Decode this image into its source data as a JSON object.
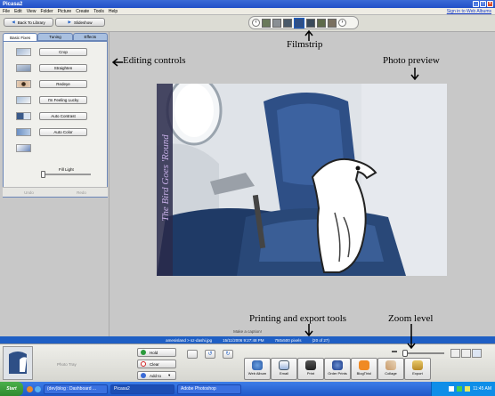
{
  "window": {
    "title": "Picasa2",
    "sign_in": "Sign in to Web Albums"
  },
  "menu": [
    "File",
    "Edit",
    "View",
    "Folder",
    "Picture",
    "Create",
    "Tools",
    "Help"
  ],
  "top": {
    "back_label": "Back To Library",
    "slideshow_label": "Slideshow"
  },
  "tabs": [
    "Basic Fixes",
    "Tuning",
    "Effects"
  ],
  "tools": [
    "Crop",
    "Straighten",
    "Redeye",
    "I'm Feeling Lucky",
    "Auto Contrast",
    "Auto Color"
  ],
  "fill_light": {
    "label": "Fill Light",
    "value": 0
  },
  "undo_label": "Undo",
  "redo_label": "Redo",
  "photo": {
    "watermark": "The Bird Goes 'Round"
  },
  "caption_hint": "Make a caption!",
  "status": {
    "path": "amesisland > sz-dashi.jpg",
    "date": "15/11/2006 9:27:48 PM",
    "size": "750x500 pixels",
    "index": "(20 of 27)"
  },
  "tray": {
    "label": "Photo Tray",
    "hold": "Hold",
    "clear": "Clear",
    "add_to": "Add to"
  },
  "export_buttons": [
    "Web Album",
    "Email",
    "Print",
    "Order Prints",
    "BlogThis!",
    "Collage",
    "Export"
  ],
  "zoom": {
    "level": 0.02
  },
  "taskbar": {
    "start": "Start",
    "items": [
      "(dev)blog : Dashboard ...",
      "Picasa2",
      "Adobe Photoshop"
    ],
    "clock": "11:45 AM"
  },
  "annotations": {
    "filmstrip": "Filmstrip",
    "editing_controls": "Editing controls",
    "photo_preview": "Photo preview",
    "printing_export": "Printing and export tools",
    "zoom_level": "Zoom level"
  },
  "colors": {
    "title_bar": "#2150c8",
    "status_bar": "#1f5fc4",
    "seat_blue": "#2e4f86",
    "tab_active": "#ffffff"
  }
}
